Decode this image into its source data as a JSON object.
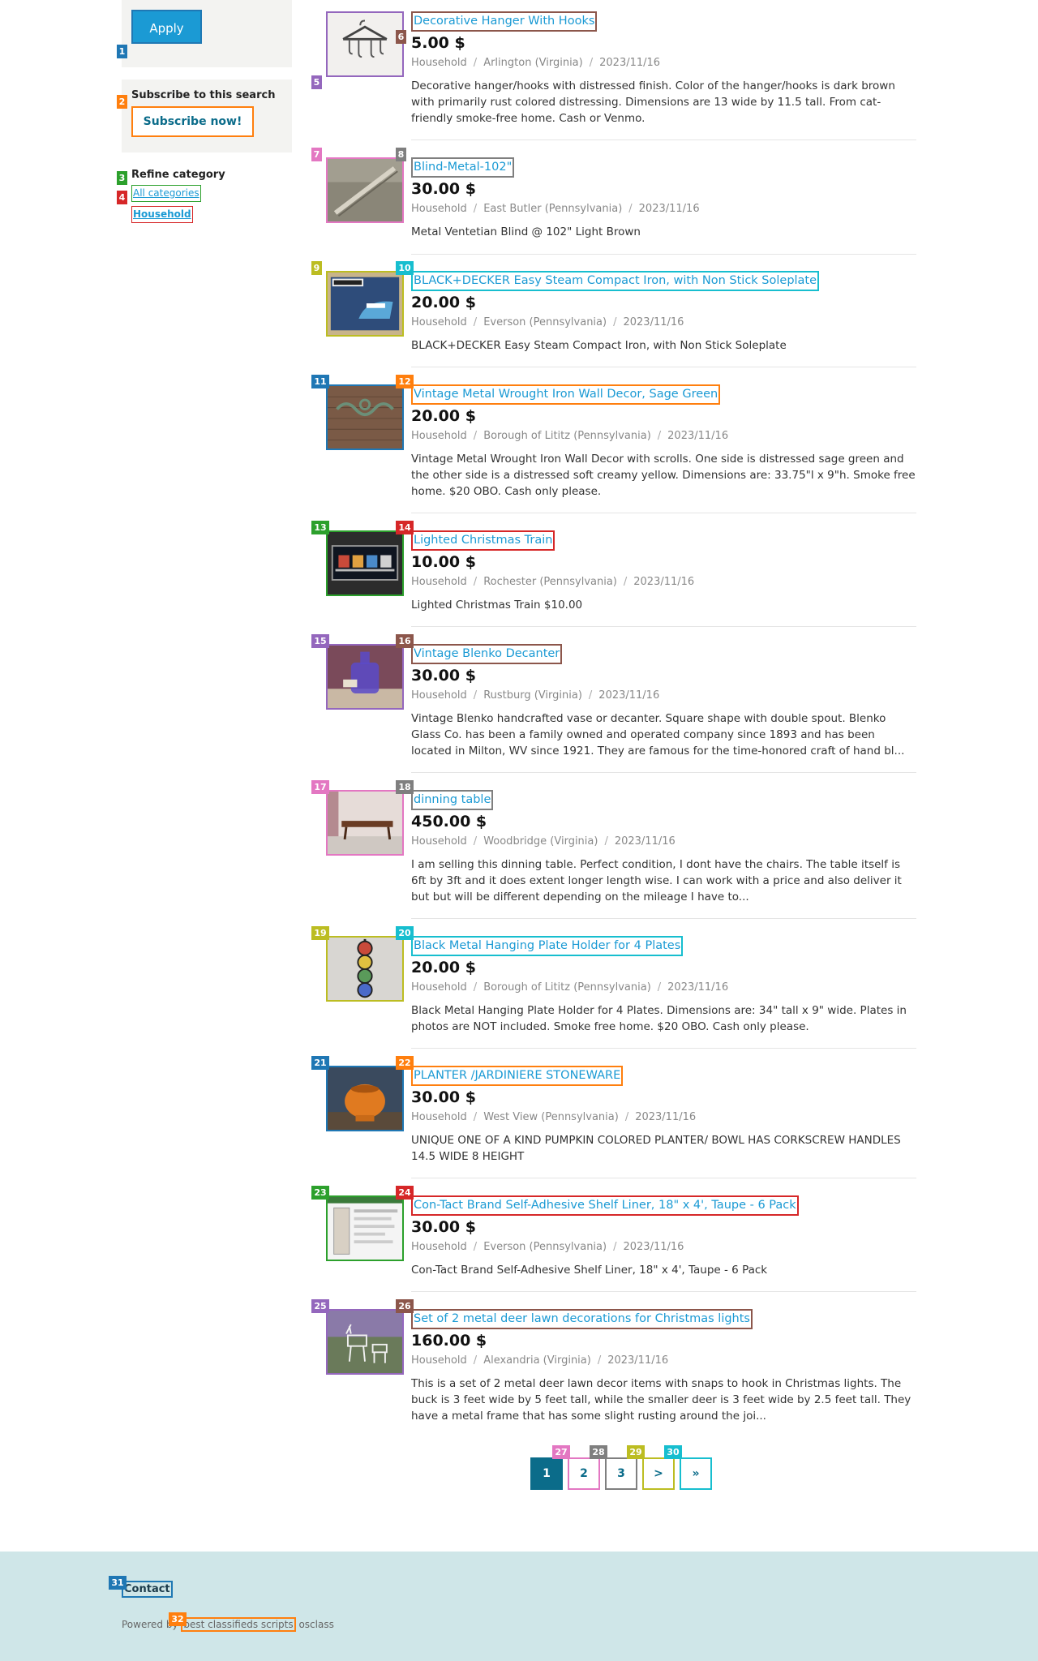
{
  "sidebar": {
    "apply_label": "Apply",
    "subscribe_title": "Subscribe to this search",
    "subscribe_button": "Subscribe now!",
    "refine_title": "Refine category",
    "category_all": "All categories",
    "category_current": "Household"
  },
  "colors": {
    "link": "#1b9ad4",
    "accent_dark": "#0b6c8a",
    "footer_bg": "#cfe6e8"
  },
  "listings": [
    {
      "title": "Decorative Hanger With Hooks",
      "price": "5.00 $",
      "category": "Household",
      "location": "Arlington (Virginia)",
      "date": "2023/11/16",
      "description": "Decorative hanger/hooks with distressed finish. Color of the hanger/hooks is dark brown with primarily rust colored distressing. Dimensions are 13 wide by 11.5 tall. From cat-friendly smoke-free home. Cash or Venmo.",
      "thumb_icon": "hanger-photo"
    },
    {
      "title": "Blind-Metal-102\"",
      "price": "30.00 $",
      "category": "Household",
      "location": "East Butler (Pennsylvania)",
      "date": "2023/11/16",
      "description": "Metal Ventetian Blind @ 102\" Light Brown",
      "thumb_icon": "blind-photo"
    },
    {
      "title": "BLACK+DECKER Easy Steam Compact Iron, with Non Stick Soleplate",
      "price": "20.00 $",
      "category": "Household",
      "location": "Everson (Pennsylvania)",
      "date": "2023/11/16",
      "description": "BLACK+DECKER Easy Steam Compact Iron, with Non Stick Soleplate",
      "thumb_icon": "iron-box-photo"
    },
    {
      "title": "Vintage Metal Wrought Iron Wall Decor, Sage Green",
      "price": "20.00 $",
      "category": "Household",
      "location": "Borough of Lititz (Pennsylvania)",
      "date": "2023/11/16",
      "description": "Vintage Metal Wrought Iron Wall Decor with scrolls. One side is distressed sage green and the other side is a distressed soft creamy yellow. Dimensions are: 33.75\"l x 9\"h. Smoke free home. $20 OBO. Cash only please.",
      "thumb_icon": "wall-decor-photo"
    },
    {
      "title": "Lighted Christmas Train",
      "price": "10.00 $",
      "category": "Household",
      "location": "Rochester (Pennsylvania)",
      "date": "2023/11/16",
      "description": "Lighted Christmas Train $10.00",
      "thumb_icon": "train-photo"
    },
    {
      "title": "Vintage Blenko Decanter",
      "price": "30.00 $",
      "category": "Household",
      "location": "Rustburg (Virginia)",
      "date": "2023/11/16",
      "description": "Vintage Blenko handcrafted vase or decanter. Square shape with double spout. Blenko Glass Co. has been a family owned and operated company since 1893 and has been located in Milton, WV since 1921. They are famous for the time-honored craft of hand bl...",
      "thumb_icon": "decanter-photo"
    },
    {
      "title": "dinning table",
      "price": "450.00 $",
      "category": "Household",
      "location": "Woodbridge (Virginia)",
      "date": "2023/11/16",
      "description": "I am selling this dinning table. Perfect condition, I dont have the chairs. The table itself is 6ft by 3ft and it does extent longer length wise. I can work with a price and also deliver it but but will be different depending on the mileage I have to...",
      "thumb_icon": "table-photo"
    },
    {
      "title": "Black Metal Hanging Plate Holder for 4 Plates",
      "price": "20.00 $",
      "category": "Household",
      "location": "Borough of Lititz (Pennsylvania)",
      "date": "2023/11/16",
      "description": "Black Metal Hanging Plate Holder for 4 Plates. Dimensions are: 34\" tall x 9\" wide. Plates in photos are NOT included. Smoke free home. $20 OBO. Cash only please.",
      "thumb_icon": "plate-holder-photo"
    },
    {
      "title": "PLANTER /JARDINIERE STONEWARE",
      "price": "30.00 $",
      "category": "Household",
      "location": "West View (Pennsylvania)",
      "date": "2023/11/16",
      "description": "UNIQUE ONE OF A KIND PUMPKIN COLORED PLANTER/ BOWL HAS CORKSCREW HANDLES 14.5 WIDE 8 HEIGHT",
      "thumb_icon": "planter-photo"
    },
    {
      "title": "Con-Tact Brand Self-Adhesive Shelf Liner, 18\" x 4', Taupe - 6 Pack",
      "price": "30.00 $",
      "category": "Household",
      "location": "Everson (Pennsylvania)",
      "date": "2023/11/16",
      "description": "Con-Tact Brand Self-Adhesive Shelf Liner, 18\" x 4', Taupe - 6 Pack",
      "thumb_icon": "shelf-liner-photo"
    },
    {
      "title": "Set of 2 metal deer lawn decorations for Christmas lights",
      "price": "160.00 $",
      "category": "Household",
      "location": "Alexandria (Virginia)",
      "date": "2023/11/16",
      "description": "This is a set of 2 metal deer lawn decor items with snaps to hook in Christmas lights. The buck is 3 feet wide by 5 feet tall, while the smaller deer is 3 feet wide by 2.5 feet tall. They have a metal frame that has some slight rusting around the joi...",
      "thumb_icon": "deer-photo"
    }
  ],
  "pagination": {
    "pages": [
      "1",
      "2",
      "3",
      ">",
      "»"
    ],
    "current": "1"
  },
  "footer": {
    "contact": "Contact",
    "powered_prefix": "Powered by",
    "powered_link": "best classifieds scripts",
    "powered_suffix": "osclass"
  },
  "badges": [
    "1",
    "2",
    "3",
    "4",
    "5",
    "6",
    "7",
    "8",
    "9",
    "10",
    "11",
    "12",
    "13",
    "14",
    "15",
    "16",
    "17",
    "18",
    "19",
    "20",
    "21",
    "22",
    "23",
    "24",
    "25",
    "26",
    "27",
    "28",
    "29",
    "30",
    "31",
    "32"
  ]
}
